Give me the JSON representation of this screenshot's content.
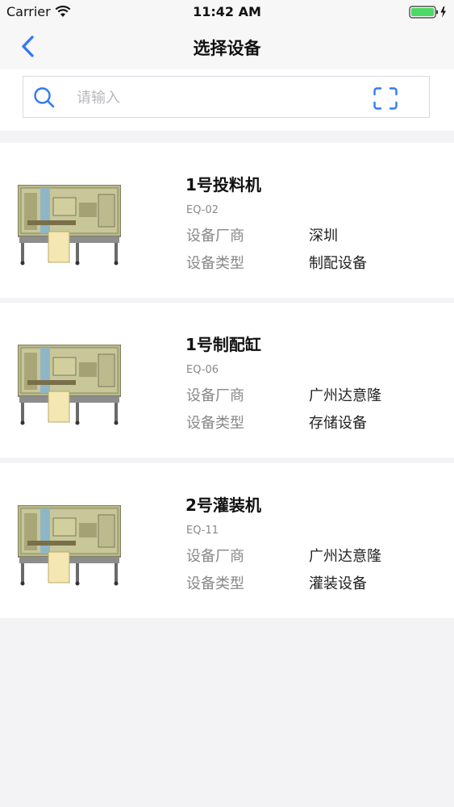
{
  "status": {
    "carrier": "Carrier",
    "time": "11:42 AM"
  },
  "nav": {
    "title": "选择设备"
  },
  "search": {
    "placeholder": "请输入"
  },
  "labels": {
    "manufacturer": "设备厂商",
    "type": "设备类型"
  },
  "devices": [
    {
      "name": "1号投料机",
      "code": "EQ-02",
      "manufacturer": "深圳",
      "type": "制配设备"
    },
    {
      "name": "1号制配缸",
      "code": "EQ-06",
      "manufacturer": "广州达意隆",
      "type": "存储设备"
    },
    {
      "name": "2号灌装机",
      "code": "EQ-11",
      "manufacturer": "广州达意隆",
      "type": "灌装设备"
    }
  ],
  "colors": {
    "accent": "#3478f6",
    "battery": "#4cd964",
    "background": "#f3f3f5"
  },
  "icons": {
    "back": "chevron-left-icon",
    "search": "search-icon",
    "scan": "scan-icon"
  }
}
